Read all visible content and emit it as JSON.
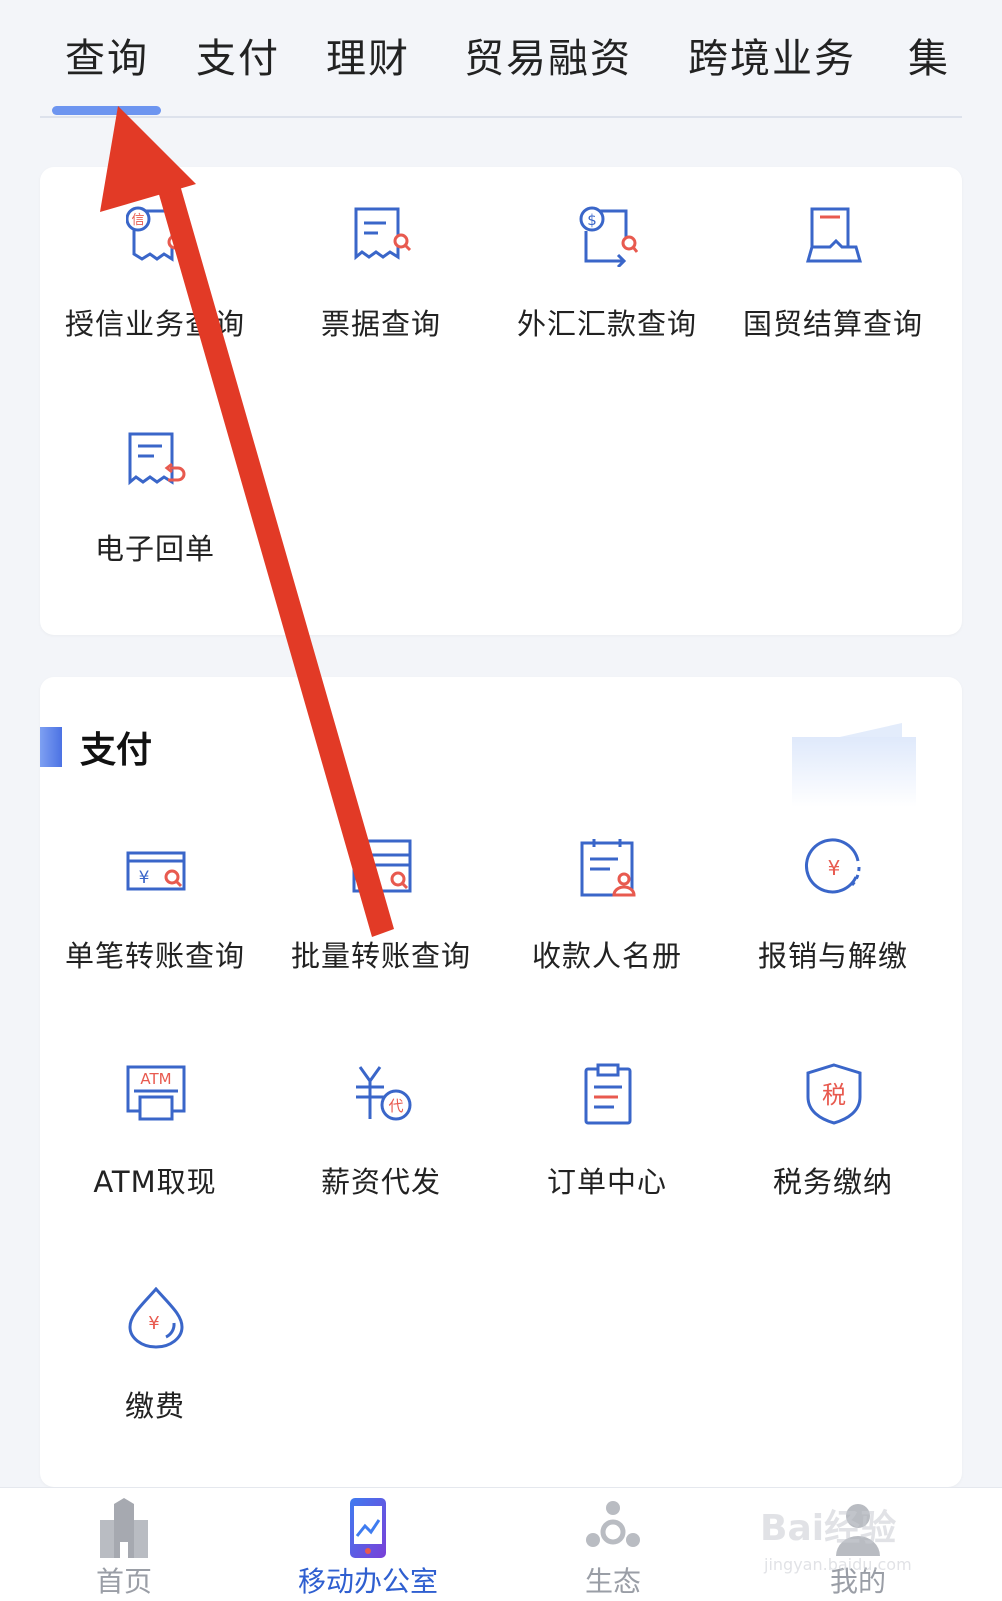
{
  "tabs": {
    "items": [
      "查询",
      "支付",
      "理财",
      "贸易融资",
      "跨境业务",
      "集"
    ],
    "active_index": 0
  },
  "query_section": {
    "items": [
      {
        "label": "授信业务查询",
        "icon": "credit-query-icon"
      },
      {
        "label": "票据查询",
        "icon": "bill-query-icon"
      },
      {
        "label": "外汇汇款查询",
        "icon": "forex-remittance-icon"
      },
      {
        "label": "国贸结算查询",
        "icon": "trade-settlement-icon"
      },
      {
        "label": "电子回单",
        "icon": "e-receipt-icon"
      }
    ]
  },
  "pay_section": {
    "title": "支付",
    "items": [
      {
        "label": "单笔转账查询",
        "icon": "single-transfer-icon"
      },
      {
        "label": "批量转账查询",
        "icon": "batch-transfer-icon"
      },
      {
        "label": "收款人名册",
        "icon": "payee-list-icon"
      },
      {
        "label": "报销与解缴",
        "icon": "reimburse-icon"
      },
      {
        "label": "ATM取现",
        "icon": "atm-icon",
        "icon_text": "ATM"
      },
      {
        "label": "薪资代发",
        "icon": "payroll-icon",
        "icon_text": "代"
      },
      {
        "label": "订单中心",
        "icon": "order-center-icon"
      },
      {
        "label": "税务缴纳",
        "icon": "tax-icon",
        "icon_text": "税"
      },
      {
        "label": "缴费",
        "icon": "fee-payment-icon"
      }
    ]
  },
  "bottom_nav": {
    "items": [
      "首页",
      "移动办公室",
      "生态",
      "我的"
    ],
    "active_index": 1
  },
  "watermark": {
    "text": "Bai经验",
    "sub": "jingyan.baidu.com"
  },
  "colors": {
    "accent": "#2f5fd0",
    "icon_blue": "#3a66c9",
    "icon_red": "#e85a4f",
    "arrow": "#e23a26",
    "background": "#f3f5f9"
  }
}
